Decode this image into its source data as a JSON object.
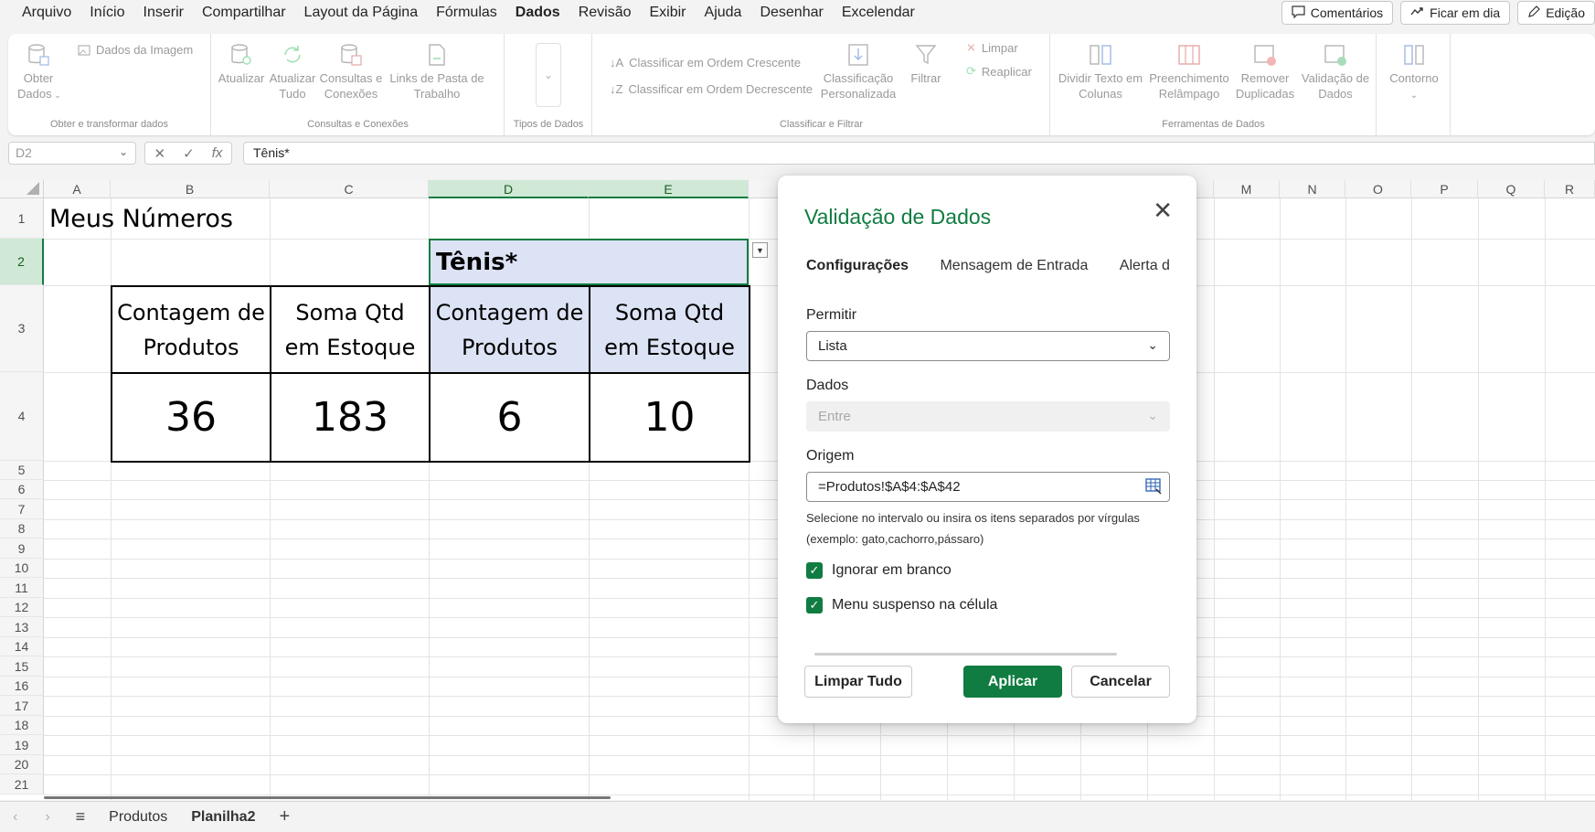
{
  "menu": {
    "items": [
      "Arquivo",
      "Início",
      "Inserir",
      "Compartilhar",
      "Layout da Página",
      "Fórmulas",
      "Dados",
      "Revisão",
      "Exibir",
      "Ajuda",
      "Desenhar",
      "Excelendar"
    ],
    "active_index": 6,
    "comments_label": "Comentários",
    "catchup_label": "Ficar em dia",
    "editing_label": "Edição"
  },
  "ribbon": {
    "get_data": "Obter",
    "get_data2": "Dados",
    "data_from_picture": "Dados da Imagem",
    "group_get_transform": "Obter e transformar dados",
    "refresh": "Atualizar",
    "refresh_all": "Atualizar",
    "refresh_all2": "Tudo",
    "queries": "Consultas e",
    "queries2": "Conexões",
    "workbook_links": "Links de Pasta de",
    "workbook_links2": "Trabalho",
    "group_queries": "Consultas e Conexões",
    "group_data_types": "Tipos de Dados",
    "sort_asc": "Classificar em Ordem Crescente",
    "sort_desc": "Classificar em Ordem Decrescente",
    "custom_sort": "Classificação",
    "custom_sort2": "Personalizada",
    "filter": "Filtrar",
    "clear": "Limpar",
    "reapply": "Reaplicar",
    "group_sort_filter": "Classificar e Filtrar",
    "text_to_columns": "Dividir Texto em",
    "text_to_columns2": "Colunas",
    "flash_fill": "Preenchimento",
    "flash_fill2": "Relâmpago",
    "remove_dup": "Remover",
    "remove_dup2": "Duplicadas",
    "validation": "Validação de",
    "validation2": "Dados",
    "group_data_tools": "Ferramentas de Dados",
    "outline": "Contorno"
  },
  "formula_bar": {
    "name_box": "D2",
    "formula": "Tênis*"
  },
  "grid": {
    "columns": [
      "A",
      "B",
      "C",
      "D",
      "E",
      "M",
      "N",
      "O",
      "P",
      "Q",
      "R"
    ],
    "rows": [
      "1",
      "2",
      "3",
      "4",
      "5",
      "6",
      "7",
      "8",
      "9",
      "10",
      "11",
      "12",
      "13",
      "14",
      "15",
      "16",
      "17",
      "18",
      "19",
      "20",
      "21"
    ],
    "title": "Meus Números",
    "category_header": "Tênis*",
    "hdr_b_1": "Contagem de",
    "hdr_b_2": "Produtos",
    "hdr_c_1": "Soma Qtd",
    "hdr_c_2": "em Estoque",
    "hdr_d_1": "Contagem de",
    "hdr_d_2": "Produtos",
    "hdr_e_1": "Soma Qtd",
    "hdr_e_2": "em Estoque",
    "val_b": "36",
    "val_c": "183",
    "val_d": "6",
    "val_e": "10"
  },
  "sheets": {
    "tabs": [
      "Produtos",
      "Planilha2"
    ],
    "active_index": 1
  },
  "dialog": {
    "title": "Validação de Dados",
    "tabs": [
      "Configurações",
      "Mensagem de Entrada",
      "Alerta de E"
    ],
    "allow_label": "Permitir",
    "allow_value": "Lista",
    "data_label": "Dados",
    "data_value": "Entre",
    "source_label": "Origem",
    "source_value": "=Produtos!$A$4:$A$42",
    "hint_line1": "Selecione no intervalo ou insira os itens separados por vírgulas",
    "hint_line2": "(exemplo: gato,cachorro,pássaro)",
    "ignore_blank": "Ignorar em branco",
    "ignore_blank_checked": true,
    "in_cell_dropdown": "Menu suspenso na célula",
    "in_cell_dropdown_checked": true,
    "clear_all": "Limpar Tudo",
    "apply": "Aplicar",
    "cancel": "Cancelar"
  },
  "colors": {
    "accent": "#107c41",
    "selection_fill": "#dbe3f4"
  }
}
